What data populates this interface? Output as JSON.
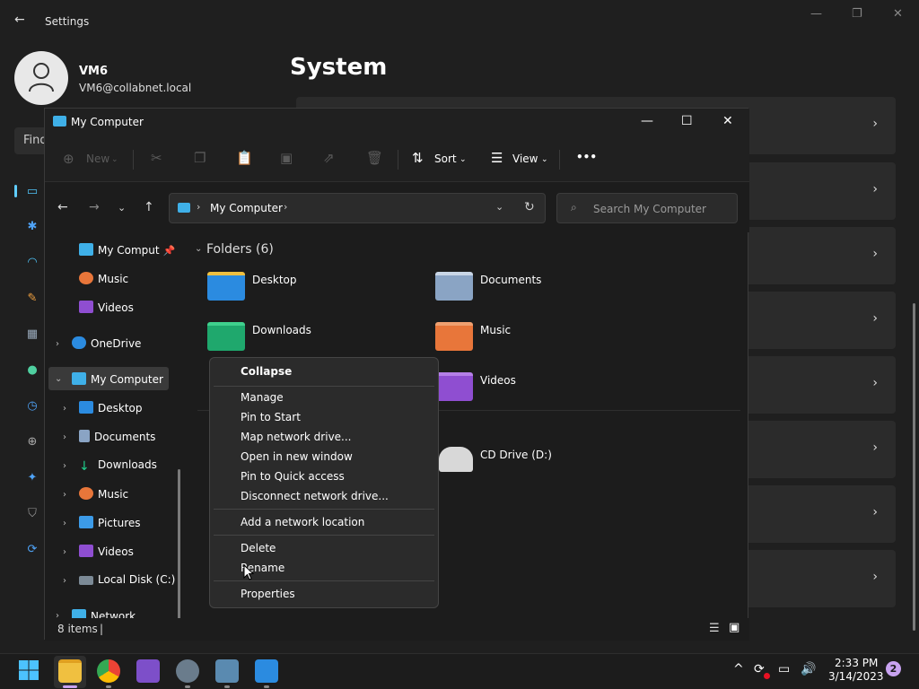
{
  "settings": {
    "title": "Settings",
    "user_name": "VM6",
    "user_email": "VM6@collabnet.local",
    "page_title": "System",
    "find_placeholder": "Find"
  },
  "explorer": {
    "title": "My Computer",
    "toolbar": {
      "new_label": "New",
      "sort_label": "Sort",
      "view_label": "View",
      "more_label": "•••"
    },
    "address": {
      "location": "My Computer",
      "search_placeholder": "Search My Computer"
    },
    "tree": [
      {
        "label": "My Comput",
        "icon": "monitor-icon",
        "pinned": true
      },
      {
        "label": "Music",
        "icon": "music-icon"
      },
      {
        "label": "Videos",
        "icon": "video-icon"
      },
      {
        "label": "OneDrive",
        "icon": "cloud-icon"
      },
      {
        "label": "My Computer",
        "icon": "monitor-icon",
        "selected": true
      },
      {
        "label": "Desktop",
        "icon": "desktop-icon"
      },
      {
        "label": "Documents",
        "icon": "document-icon"
      },
      {
        "label": "Downloads",
        "icon": "download-icon"
      },
      {
        "label": "Music",
        "icon": "music-icon"
      },
      {
        "label": "Pictures",
        "icon": "picture-icon"
      },
      {
        "label": "Videos",
        "icon": "video-icon"
      },
      {
        "label": "Local Disk (C:)",
        "icon": "disk-icon"
      },
      {
        "label": "Network",
        "icon": "network-icon"
      }
    ],
    "group_header": "Folders (6)",
    "folders": [
      {
        "label": "Desktop",
        "color": "#2b8be0"
      },
      {
        "label": "Documents",
        "color": "#8aa4c4"
      },
      {
        "label": "Downloads",
        "color": "#1fa86d"
      },
      {
        "label": "Music",
        "color": "#e8763a"
      },
      {
        "label": "Videos",
        "color": "#8f4ed1"
      }
    ],
    "drives": [
      {
        "label": "CD Drive (D:)"
      }
    ],
    "status_text": "8 items"
  },
  "context_menu": {
    "items": [
      {
        "label": "Collapse",
        "bold": true
      },
      {
        "label": "Manage"
      },
      {
        "label": "Pin to Start"
      },
      {
        "label": "Map network drive..."
      },
      {
        "label": "Open in new window"
      },
      {
        "label": "Pin to Quick access"
      },
      {
        "label": "Disconnect network drive..."
      },
      {
        "label": "Add a network location"
      },
      {
        "label": "Delete"
      },
      {
        "label": "Rename"
      },
      {
        "label": "Properties"
      }
    ]
  },
  "taskbar": {
    "time": "2:33 PM",
    "date": "3/14/2023",
    "notification_count": "2"
  },
  "colors": {
    "accent": "#60cdff",
    "folder_yellow": "#f0c040"
  }
}
